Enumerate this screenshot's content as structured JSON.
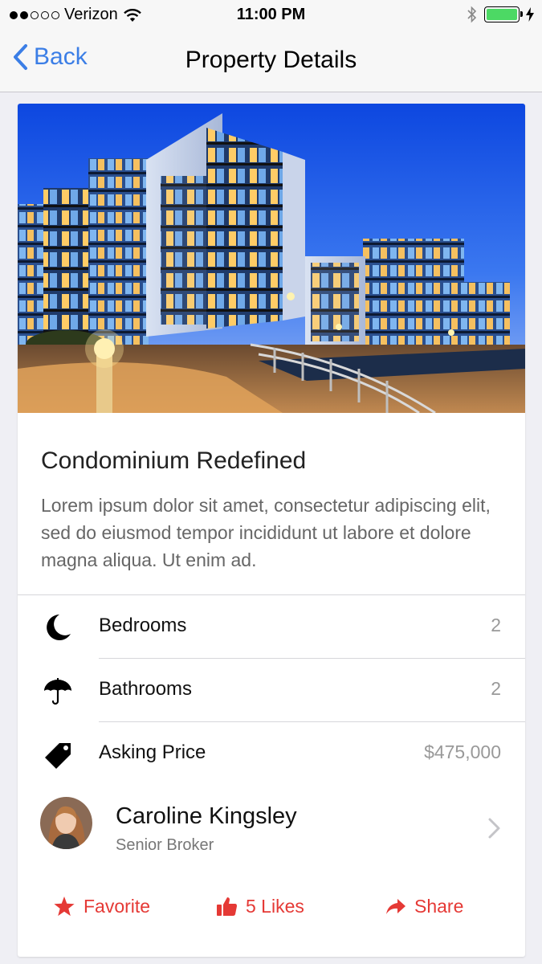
{
  "status_bar": {
    "carrier": "Verizon",
    "time": "11:00 PM",
    "signal_bars_filled": 2,
    "signal_bars_total": 5,
    "battery_level": 1.0,
    "icons": [
      "wifi-icon",
      "bluetooth-icon",
      "battery-icon",
      "charging-bolt-icon"
    ]
  },
  "nav": {
    "back_label": "Back",
    "title": "Property Details"
  },
  "property": {
    "title": "Condominium Redefined",
    "description": "Lorem ipsum dolor sit amet, consectetur adipiscing elit, sed do eiusmod tempor incididunt ut labore et dolore magna aliqua. Ut enim ad."
  },
  "details": [
    {
      "icon": "moon-icon",
      "label": "Bedrooms",
      "value": "2"
    },
    {
      "icon": "umbrella-icon",
      "label": "Bathrooms",
      "value": "2"
    },
    {
      "icon": "price-tag-icon",
      "label": "Asking Price",
      "value": "$475,000"
    }
  ],
  "broker": {
    "name": "Caroline Kingsley",
    "role": "Senior Broker"
  },
  "actions": {
    "favorite": "Favorite",
    "likes": "5 Likes",
    "share": "Share"
  },
  "colors": {
    "accent_blue": "#3b7ee6",
    "action_red": "#e53935",
    "value_gray": "#999999",
    "battery_green": "#4cd964"
  }
}
